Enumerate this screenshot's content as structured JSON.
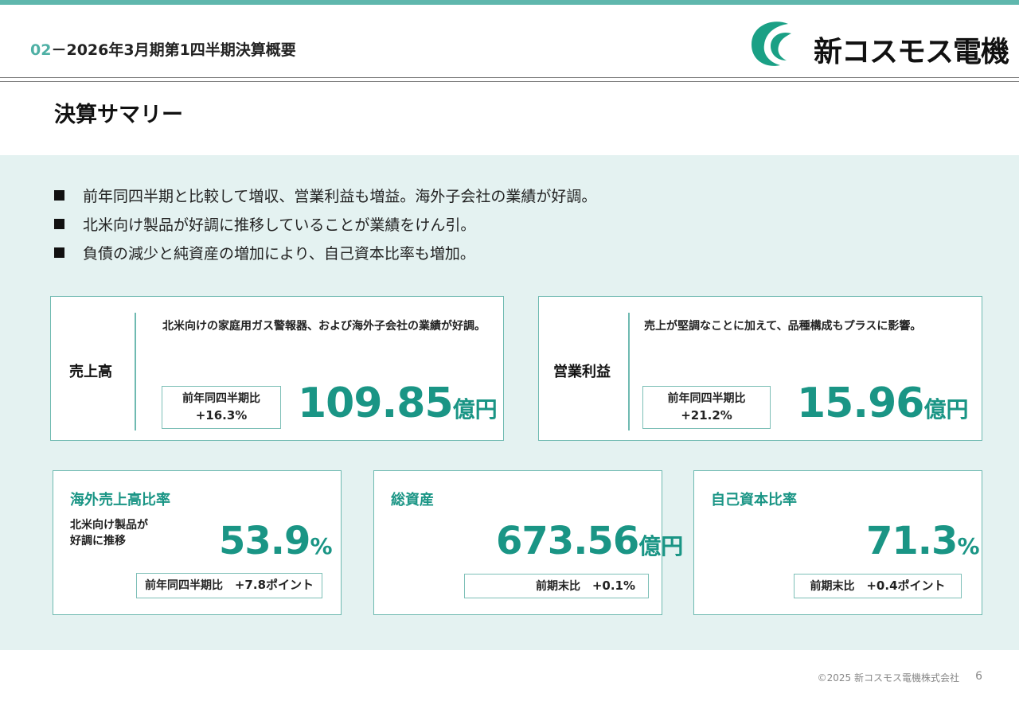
{
  "header": {
    "section_number": "02",
    "section_separator": "－",
    "section_title": "2026年3月期第1四半期決算概要",
    "company_logo_text": "新コスモス電機"
  },
  "page_title": "決算サマリー",
  "bullets": [
    "前年同四半期と比較して増収、営業利益も増益。海外子会社の業績が好調。",
    "北米向け製品が好調に推移していることが業績をけん引。",
    "負債の減少と純資産の増加により、自己資本比率も増加。"
  ],
  "cards": {
    "sales": {
      "label": "売上高",
      "description": "北米向けの家庭用ガス警報器、および海外子会社の業績が好調。",
      "comparison_label": "前年同四半期比",
      "comparison_value": "+16.3%",
      "value": "109.85",
      "unit": "億円"
    },
    "operating_income": {
      "label": "営業利益",
      "description": "売上が堅調なことに加えて、品種構成もプラスに影響。",
      "comparison_label": "前年同四半期比",
      "comparison_value": "+21.2%",
      "value": "15.96",
      "unit": "億円"
    },
    "overseas_ratio": {
      "label": "海外売上高比率",
      "note_line1": "北米向け製品が",
      "note_line2": "好調に推移",
      "value": "53.9",
      "unit": "%",
      "comparison_label": "前年同四半期比",
      "comparison_value": "+7.8ポイント"
    },
    "total_assets": {
      "label": "総資産",
      "value": "673.56",
      "unit": "億円",
      "comparison_label": "前期末比",
      "comparison_value": "+0.1%"
    },
    "equity_ratio": {
      "label": "自己資本比率",
      "value": "71.3",
      "unit": "%",
      "comparison_label": "前期末比",
      "comparison_value": "+0.4ポイント"
    }
  },
  "footer": {
    "copyright": "©2025 新コスモス電機株式会社",
    "page_number": "6"
  },
  "colors": {
    "accent": "#1a9585",
    "border": "#6fbab1",
    "panel_bg": "#e4f2f1",
    "top_bar": "#5fb7ad"
  }
}
